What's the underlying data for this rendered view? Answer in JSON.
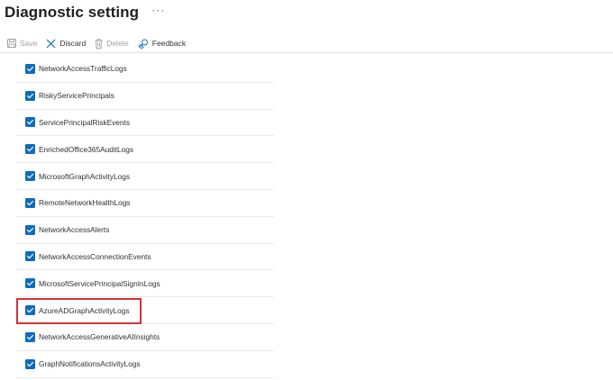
{
  "header": {
    "title": "Diagnostic setting",
    "more_label": "···"
  },
  "toolbar": {
    "save_label": "Save",
    "discard_label": "Discard",
    "delete_label": "Delete",
    "feedback_label": "Feedback"
  },
  "colors": {
    "checkbox": "#0f6cbd",
    "highlight": "#d13438",
    "accent": "#0f6cbd"
  },
  "logs": [
    {
      "label": "NetworkAccessTrafficLogs",
      "checked": true
    },
    {
      "label": "RiskyServicePrincipals",
      "checked": true
    },
    {
      "label": "ServicePrincipalRiskEvents",
      "checked": true
    },
    {
      "label": "EnrichedOffice365AuditLogs",
      "checked": true
    },
    {
      "label": "MicrosoftGraphActivityLogs",
      "checked": true
    },
    {
      "label": "RemoteNetworkHealthLogs",
      "checked": true
    },
    {
      "label": "NetworkAccessAlerts",
      "checked": true
    },
    {
      "label": "NetworkAccessConnectionEvents",
      "checked": true
    },
    {
      "label": "MicrosoftServicePrincipalSignInLogs",
      "checked": true
    },
    {
      "label": "AzureADGraphActivityLogs",
      "checked": true,
      "highlighted": true
    },
    {
      "label": "NetworkAccessGenerativeAIInsights",
      "checked": true
    },
    {
      "label": "GraphNotificationsActivityLogs",
      "checked": true
    }
  ]
}
